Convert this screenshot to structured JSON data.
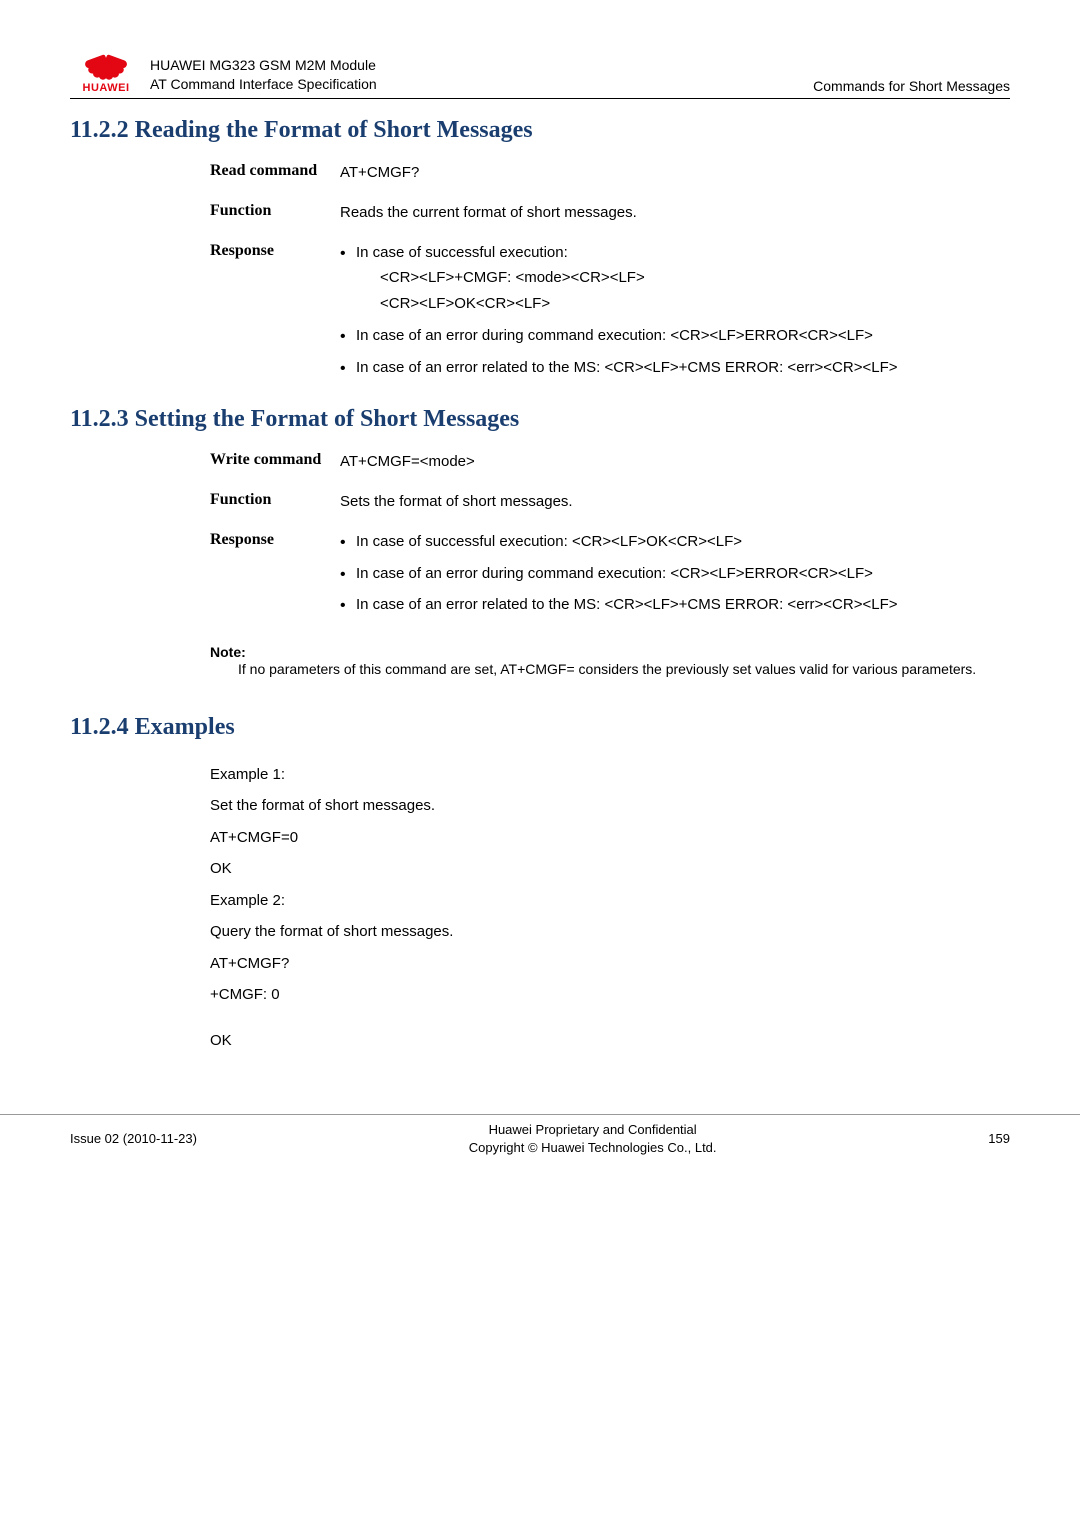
{
  "header": {
    "logo_text": "HUAWEI",
    "title_line1": "HUAWEI MG323 GSM M2M Module",
    "title_line2": "AT Command Interface Specification",
    "right": "Commands for Short Messages"
  },
  "s1": {
    "heading": "11.2.2 Reading the Format of Short Messages",
    "row1": {
      "label": "Read command",
      "value": "AT+CMGF?"
    },
    "row2": {
      "label": "Function",
      "value": "Reads the current format of short messages."
    },
    "row3": {
      "label": "Response",
      "b1": "In case of successful execution:",
      "b1a": "<CR><LF>+CMGF: <mode><CR><LF>",
      "b1b": "<CR><LF>OK<CR><LF>",
      "b2": "In case of an error during command execution: <CR><LF>ERROR<CR><LF>",
      "b3": "In case of an error related to the MS: <CR><LF>+CMS ERROR: <err><CR><LF>"
    }
  },
  "s2": {
    "heading": "11.2.3 Setting the Format of Short Messages",
    "row1": {
      "label": "Write command",
      "value": "AT+CMGF=<mode>"
    },
    "row2": {
      "label": "Function",
      "value": "Sets the format of short messages."
    },
    "row3": {
      "label": "Response",
      "b1": "In case of successful execution: <CR><LF>OK<CR><LF>",
      "b2": "In case of an error during command execution: <CR><LF>ERROR<CR><LF>",
      "b3": "In case of an error related to the MS: <CR><LF>+CMS ERROR: <err><CR><LF>"
    },
    "note_label": "Note:",
    "note_text": "If no parameters of this command are set, AT+CMGF= considers the previously set values valid for various parameters."
  },
  "s3": {
    "heading": "11.2.4 Examples",
    "lines": {
      "l1": "Example 1:",
      "l2": "Set the format of short messages.",
      "l3": "AT+CMGF=0",
      "l4": "OK",
      "l5": "Example 2:",
      "l6": "Query the format of short messages.",
      "l7": "AT+CMGF?",
      "l8": "+CMGF: 0",
      "l9": "OK"
    }
  },
  "footer": {
    "left": "Issue 02 (2010-11-23)",
    "center1": "Huawei Proprietary and Confidential",
    "center2": "Copyright © Huawei Technologies Co., Ltd.",
    "right": "159"
  }
}
